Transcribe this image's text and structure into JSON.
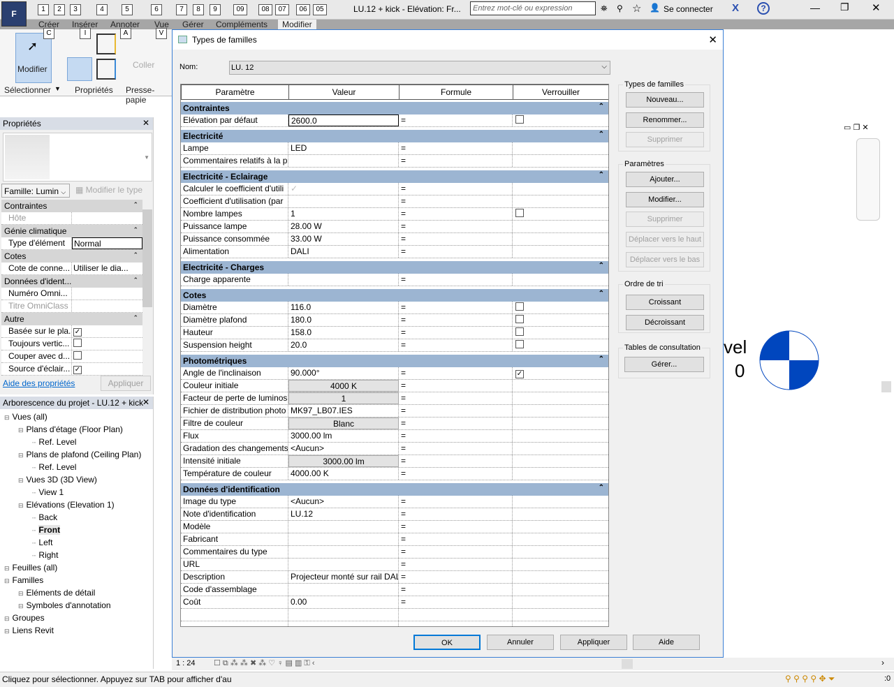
{
  "app": {
    "title": "LU.12 + kick - Elévation: Fr...",
    "search_placeholder": "Entrez mot-clé ou expression",
    "signin": "Se connecter",
    "app_letter": "F",
    "qat_keys": [
      "1",
      "2",
      "3",
      "4",
      "5",
      "6",
      "7",
      "8",
      "9",
      "09",
      "08",
      "07",
      "06",
      "05"
    ]
  },
  "ribbon": {
    "tabs": [
      "Créer",
      "Insérer",
      "Annoter",
      "Vue",
      "Gérer",
      "Compléments",
      "Modifier"
    ],
    "keytips": [
      "C",
      "I",
      "A",
      "V"
    ],
    "modify": "Modifier",
    "coller": "Coller",
    "panels": [
      "Sélectionner",
      "Propriétés",
      "Presse-papie"
    ]
  },
  "properties": {
    "title": "Propriétés",
    "family": "Famille: Lumin",
    "edit_type": "Modifier le type",
    "help": "Aide des propriétés",
    "apply": "Appliquer",
    "rows": [
      {
        "g": "Contraintes"
      },
      {
        "k": "Hôte",
        "v": "",
        "dim": true
      },
      {
        "g": "Génie climatique"
      },
      {
        "k": "Type d'élément",
        "v": "Normal",
        "edit": true
      },
      {
        "g": "Cotes"
      },
      {
        "k": "Cote de conne...",
        "v": "Utiliser le dia..."
      },
      {
        "g": "Données d'ident..."
      },
      {
        "k": "Numéro Omni...",
        "v": ""
      },
      {
        "k": "Titre OmniClass",
        "v": "",
        "dim": true
      },
      {
        "g": "Autre"
      },
      {
        "k": "Basée sur le pla...",
        "cb": true
      },
      {
        "k": "Toujours vertic...",
        "cb": false
      },
      {
        "k": "Couper avec d...",
        "cb": false
      },
      {
        "k": "Source d'éclair...",
        "cb": true
      }
    ]
  },
  "browser": {
    "title": "Arborescence du projet - LU.12 + kick",
    "items": [
      {
        "t": "Vues (all)",
        "l": 0
      },
      {
        "t": "Plans d'étage (Floor Plan)",
        "l": 1
      },
      {
        "t": "Ref. Level",
        "l": 2
      },
      {
        "t": "Plans de plafond (Ceiling Plan)",
        "l": 1
      },
      {
        "t": "Ref. Level",
        "l": 2
      },
      {
        "t": "Vues 3D (3D View)",
        "l": 1
      },
      {
        "t": "View 1",
        "l": 2
      },
      {
        "t": "Elévations (Elevation 1)",
        "l": 1
      },
      {
        "t": "Back",
        "l": 2
      },
      {
        "t": "Front",
        "l": 2,
        "bold": true
      },
      {
        "t": "Left",
        "l": 2
      },
      {
        "t": "Right",
        "l": 2
      },
      {
        "t": "Feuilles (all)",
        "l": 0
      },
      {
        "t": "Familles",
        "l": 0
      },
      {
        "t": "Eléments de détail",
        "l": 1
      },
      {
        "t": "Symboles d'annotation",
        "l": 1
      },
      {
        "t": "Groupes",
        "l": 0
      },
      {
        "t": "Liens Revit",
        "l": 0
      }
    ]
  },
  "dialog": {
    "title": "Types de familles",
    "name_label": "Nom:",
    "name_value": "LU. 12",
    "columns": [
      "Paramètre",
      "Valeur",
      "Formule",
      "Verrouiller"
    ],
    "groups": [
      {
        "name": "Contraintes",
        "rows": [
          {
            "p": "Elévation par défaut",
            "v": "2600.0",
            "edit": true,
            "lock": false
          }
        ]
      },
      {
        "name": "Electricité",
        "rows": [
          {
            "p": "Lampe",
            "v": "LED"
          },
          {
            "p": "Commentaires relatifs à la p",
            "v": ""
          }
        ]
      },
      {
        "name": "Electricité - Eclairage",
        "rows": [
          {
            "p": "Calculer le coefficient d'utili",
            "v": "✓",
            "dimcheck": true
          },
          {
            "p": "Coefficient d'utilisation (par",
            "v": ""
          },
          {
            "p": "Nombre lampes",
            "v": "1",
            "lock": false
          },
          {
            "p": "Puissance lampe",
            "v": "28.00 W"
          },
          {
            "p": "Puissance consommée",
            "v": "33.00 W"
          },
          {
            "p": "Alimentation",
            "v": "DALI"
          }
        ]
      },
      {
        "name": "Electricité - Charges",
        "rows": [
          {
            "p": "Charge apparente",
            "v": ""
          }
        ]
      },
      {
        "name": "Cotes",
        "rows": [
          {
            "p": "Diamètre",
            "v": "116.0",
            "lock": false
          },
          {
            "p": "Diamètre plafond",
            "v": "180.0",
            "lock": false
          },
          {
            "p": "Hauteur",
            "v": "158.0",
            "lock": false
          },
          {
            "p": "Suspension height",
            "v": "20.0",
            "lock": false
          }
        ]
      },
      {
        "name": "Photométriques",
        "rows": [
          {
            "p": "Angle de l'inclinaison",
            "v": "90.000°",
            "lock": true
          },
          {
            "p": "Couleur initiale",
            "v": "4000 K",
            "shade": true
          },
          {
            "p": "Facteur de perte de luminosi",
            "v": "1",
            "shade": true
          },
          {
            "p": "Fichier de distribution photo",
            "v": "MK97_LB07.IES"
          },
          {
            "p": "Filtre de couleur",
            "v": "Blanc",
            "shade": true
          },
          {
            "p": "Flux",
            "v": "3000.00 lm"
          },
          {
            "p": "Gradation des changements",
            "v": "<Aucun>"
          },
          {
            "p": "Intensité initiale",
            "v": "3000.00 lm",
            "shade": true
          },
          {
            "p": "Température de couleur",
            "v": "4000.00 K"
          }
        ]
      },
      {
        "name": "Données d'identification",
        "rows": [
          {
            "p": "Image du type",
            "v": "<Aucun>"
          },
          {
            "p": "Note d'identification",
            "v": "LU.12"
          },
          {
            "p": "Modèle",
            "v": ""
          },
          {
            "p": "Fabricant",
            "v": ""
          },
          {
            "p": "Commentaires du type",
            "v": ""
          },
          {
            "p": "URL",
            "v": ""
          },
          {
            "p": "Description",
            "v": "Projecteur monté sur rail DAL"
          },
          {
            "p": "Code d'assemblage",
            "v": ""
          },
          {
            "p": "Coût",
            "v": "0.00"
          }
        ]
      }
    ],
    "formula_eq": "=",
    "side": {
      "types_title": "Types de familles",
      "new": "Nouveau...",
      "rename": "Renommer...",
      "delete": "Supprimer",
      "params_title": "Paramètres",
      "add": "Ajouter...",
      "modify": "Modifier...",
      "pdelete": "Supprimer",
      "up": "Déplacer vers le haut",
      "down": "Déplacer vers le bas",
      "sort_title": "Ordre de tri",
      "asc": "Croissant",
      "desc": "Décroissant",
      "lookup_title": "Tables de consultation",
      "manage": "Gérer..."
    },
    "ok": "OK",
    "cancel": "Annuler",
    "apply": "Appliquer",
    "help": "Aide"
  },
  "view": {
    "level_text": "vel",
    "level_num": "0",
    "scale": "1 : 24"
  },
  "status": {
    "text": "Cliquez pour sélectionner. Appuyez sur TAB pour afficher d'au",
    "filter_count": ":0"
  },
  "colors": {
    "group_header": "#9cb5d2",
    "accent": "#0046be",
    "dialog_border": "#3a7fd5"
  }
}
